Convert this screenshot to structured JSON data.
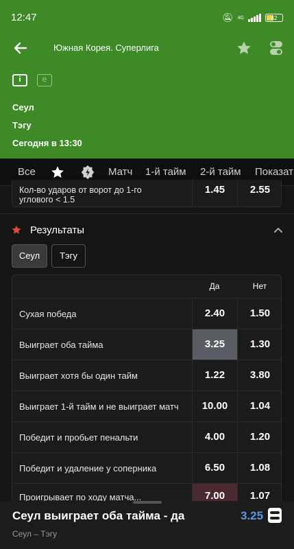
{
  "status": {
    "time": "12:47",
    "network": "4G",
    "battery": "42"
  },
  "header": {
    "title": "Южная Корея. Суперлига",
    "team_home": "Сеул",
    "team_away": "Тэгу",
    "start_time": "Сегодня в 13:30"
  },
  "tabs": [
    "Все",
    "Матч",
    "1-й тайм",
    "2-й тайм",
    "Показат"
  ],
  "prev_row": {
    "label_line1": "Кол-во ударов от ворот до 1-го",
    "label_line2": "углового < 1.5",
    "yes": "1.45",
    "no": "2.55"
  },
  "section": {
    "title": "Результаты",
    "team_tabs": [
      "Сеул",
      "Тэгу"
    ],
    "col_yes": "Да",
    "col_no": "Нет",
    "rows": [
      {
        "label": "Сухая победа",
        "yes": "2.40",
        "no": "1.50"
      },
      {
        "label": "Выиграет оба тайма",
        "yes": "3.25",
        "no": "1.30"
      },
      {
        "label": "Выиграет хотя бы один тайм",
        "yes": "1.22",
        "no": "3.80"
      },
      {
        "label": "Выиграет 1-й тайм и не выиграет матч",
        "yes": "10.00",
        "no": "1.04"
      },
      {
        "label": "Победит и пробьет пенальти",
        "yes": "4.00",
        "no": "1.20"
      },
      {
        "label": "Победит и удаление у соперника",
        "yes": "6.50",
        "no": "1.08"
      },
      {
        "label": "Проигрывает по ходу матча...",
        "yes": "7.00",
        "no": "1.07"
      }
    ]
  },
  "betslip": {
    "title": "Сеул выиграет оба тайма - да",
    "odds": "3.25",
    "subtitle": "Сеул – Тэгу"
  },
  "colors": {
    "header_green": "#3d8a27",
    "selected_cell": "#5a5d63",
    "odds_blue": "#5f96e8",
    "star_red": "#e24a3b"
  }
}
